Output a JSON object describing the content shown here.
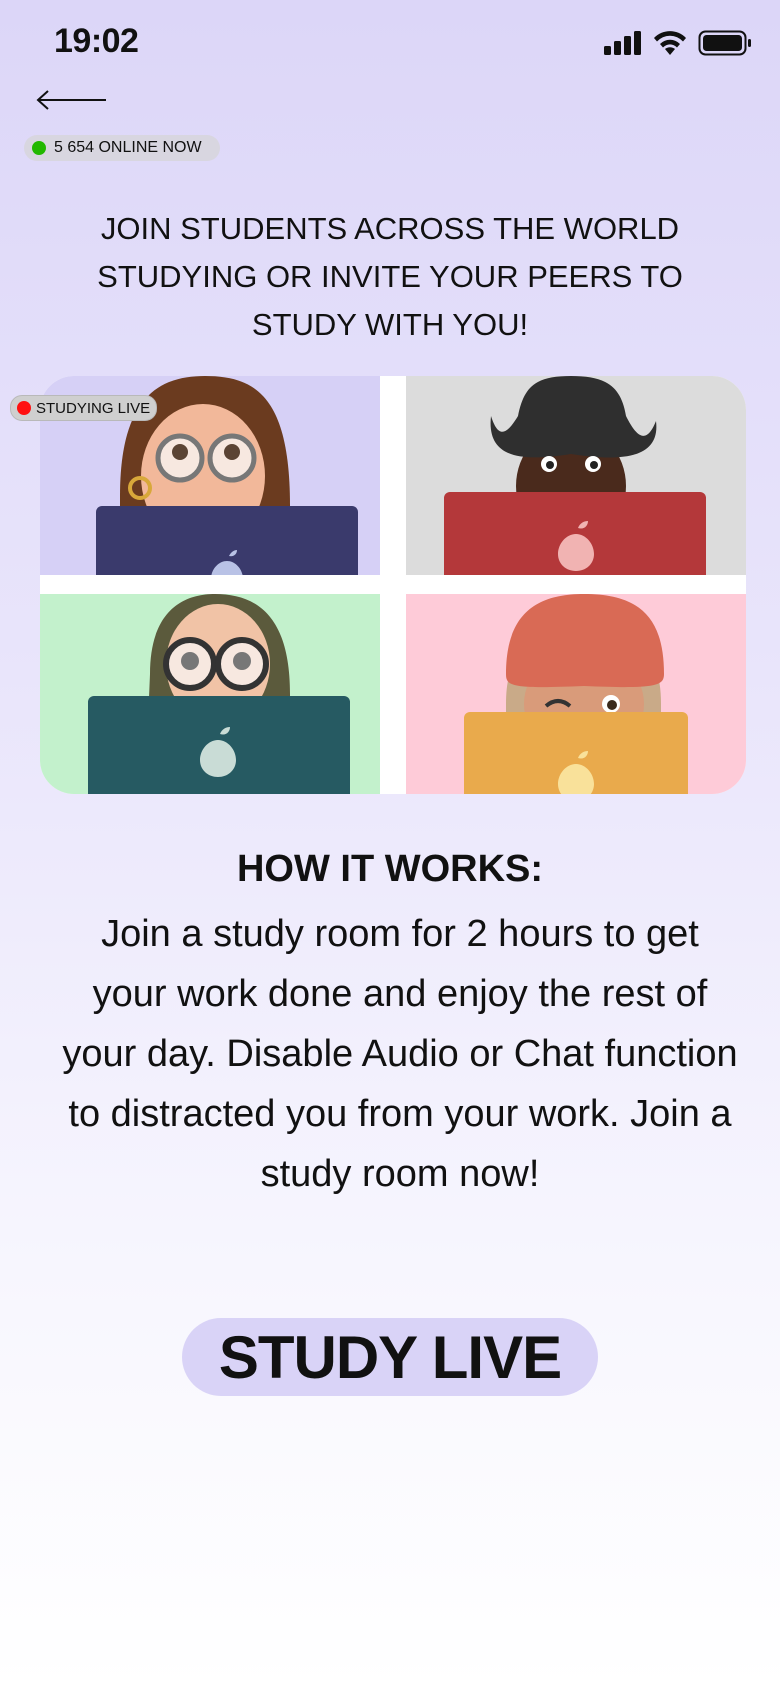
{
  "status_bar": {
    "time": "19:02"
  },
  "online": {
    "text": "5 654 ONLINE NOW",
    "dot_color": "#22b800"
  },
  "intro": {
    "text": "JOIN STUDENTS ACROSS THE WORLD STUDYING OR INVITE YOUR PEERS TO STUDY WITH YOU!"
  },
  "grid": {
    "badge_text": "STUDYING LIVE",
    "badge_dot_color": "#ff1010",
    "tiles": [
      {
        "name": "memoji-girl-glasses",
        "bg": "#d6d0f6",
        "laptop": "#3a3a6c"
      },
      {
        "name": "memoji-cowboy-hat",
        "bg": "#dcdcdc",
        "laptop": "#b4383a"
      },
      {
        "name": "memoji-hijab-glasses",
        "bg": "#c3f1cc",
        "laptop": "#265a62"
      },
      {
        "name": "memoji-beanie-wink",
        "bg": "#fecbd8",
        "laptop": "#e9aa4c"
      }
    ]
  },
  "how": {
    "title": "HOW IT WORKS:",
    "body": "Join a study room for 2 hours to get your work done and enjoy the rest of your day. Disable Audio or Chat function to distracted you from your work. Join a study room now!"
  },
  "cta": {
    "label": "STUDY LIVE",
    "bg": "#d9d3f7"
  },
  "icons": [
    "back-arrow-icon",
    "signal-icon",
    "wifi-icon",
    "battery-icon",
    "apple-logo-icon"
  ]
}
